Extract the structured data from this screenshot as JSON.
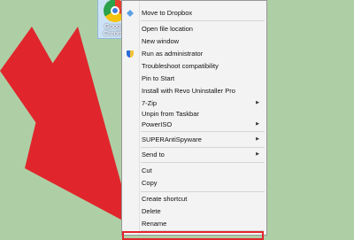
{
  "desktop": {
    "icon_label": "Google Chrome",
    "background_color": "#aecfa6"
  },
  "arrow": {
    "color": "#e0262c"
  },
  "context_menu": {
    "items": [
      {
        "label": "Move to Dropbox",
        "icon": "dropbox-icon",
        "submenu": false
      },
      {
        "label": "Open file location",
        "submenu": false
      },
      {
        "label": "New window",
        "submenu": false
      },
      {
        "label": "Run as administrator",
        "icon": "shield-icon",
        "submenu": false
      },
      {
        "label": "Troubleshoot compatibility",
        "submenu": false
      },
      {
        "label": "Pin to Start",
        "submenu": false
      },
      {
        "label": "Install with Revo Uninstaller Pro",
        "submenu": false
      },
      {
        "label": "7-Zip",
        "submenu": true
      },
      {
        "label": "Unpin from Taskbar",
        "submenu": false
      },
      {
        "label": "PowerISO",
        "submenu": true
      },
      {
        "label": "SUPERAntiSpyware",
        "submenu": true
      },
      {
        "label": "Send to",
        "submenu": true
      },
      {
        "label": "Cut",
        "submenu": false
      },
      {
        "label": "Copy",
        "submenu": false
      },
      {
        "label": "Create shortcut",
        "submenu": false
      },
      {
        "label": "Delete",
        "submenu": false
      },
      {
        "label": "Rename",
        "submenu": false
      }
    ],
    "submenu_glyph": "▶",
    "highlight_color": "#e0262c"
  }
}
